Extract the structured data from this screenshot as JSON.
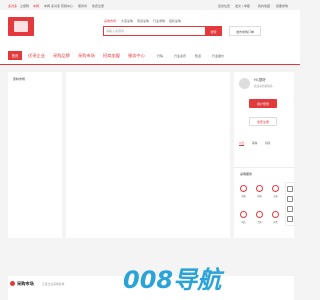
{
  "topbar": {
    "links": [
      "多对多",
      "立顺网",
      "本网",
      "本网 多对多 营销中心",
      "服务商",
      "免费注册"
    ],
    "right": [
      "您的位置",
      "发文 / 举报",
      "我的收藏",
      "我要求购"
    ]
  },
  "header": {
    "search_tabs": [
      "采购市场",
      "大宗采购",
      "现货采购",
      "行业求购",
      "招标采购"
    ],
    "search_placeholder": "请输入关键词",
    "search_button": "搜索",
    "publish_button": "发布求购订单"
  },
  "nav": {
    "home": "首页",
    "items": [
      "优采企业",
      "采购品牌",
      "采购市场",
      "招商加盟",
      "服务中心"
    ],
    "sub_items": [
      "行情",
      "行业资讯",
      "知道",
      "行业报价"
    ]
  },
  "left": {
    "category_label": "原料市场"
  },
  "right": {
    "greeting": "Hi,您好",
    "welcome": "欢迎来到采购易~",
    "login": "用户登录",
    "register": "免费注册",
    "tabs": [
      "公告",
      "采购",
      "新闻"
    ],
    "tools_title": "采购服务",
    "tools": [
      "采购",
      "商机",
      "交易",
      "供应",
      "合同",
      "开票"
    ]
  },
  "bottom": {
    "market_title": "采购市场",
    "market_sub": "汇集企业采购需求",
    "watermark": "008导航"
  },
  "colors": {
    "accent": "#e4393c"
  }
}
